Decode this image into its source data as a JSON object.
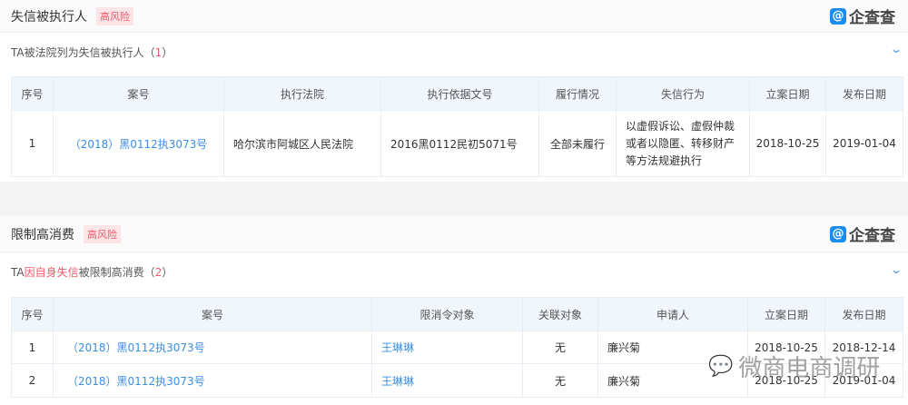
{
  "section1": {
    "title": "失信被执行人",
    "badge": "高风险",
    "logo_text": "企查查",
    "subtitle_prefix": "TA被法院列为失信被执行人（",
    "count": "1",
    "subtitle_suffix": "）",
    "headers": [
      "序号",
      "案号",
      "执行法院",
      "执行依据文号",
      "履行情况",
      "失信行为",
      "立案日期",
      "发布日期"
    ],
    "rows": [
      {
        "no": "1",
        "case": "（2018）黑0112执3073号",
        "court": "哈尔滨市阿城区人民法院",
        "basis": "2016黑0112民初5071号",
        "status": "全部未履行",
        "behavior": "以虚假诉讼、虚假仲裁或者以隐匿、转移财产等方法规避执行",
        "filed": "2018-10-25",
        "published": "2019-01-04"
      }
    ]
  },
  "section2": {
    "title": "限制高消费",
    "badge": "高风险",
    "logo_text": "企查查",
    "subtitle_prefix": "TA",
    "subtitle_red": "因自身失信",
    "subtitle_mid": "被限制高消费（",
    "count": "2",
    "subtitle_suffix": "）",
    "headers": [
      "序号",
      "案号",
      "限消令对象",
      "关联对象",
      "申请人",
      "立案日期",
      "发布日期"
    ],
    "rows": [
      {
        "no": "1",
        "case": "（2018）黑0112执3073号",
        "target": "王琳琳",
        "related": "无",
        "applicant": "廉兴菊",
        "filed": "2018-10-25",
        "published": "2018-12-14"
      },
      {
        "no": "2",
        "case": "（2018）黑0112执3073号",
        "target": "王琳琳",
        "related": "无",
        "applicant": "廉兴菊",
        "filed": "2018-10-25",
        "published": "2019-01-04"
      }
    ]
  },
  "watermark": "微商电商调研"
}
